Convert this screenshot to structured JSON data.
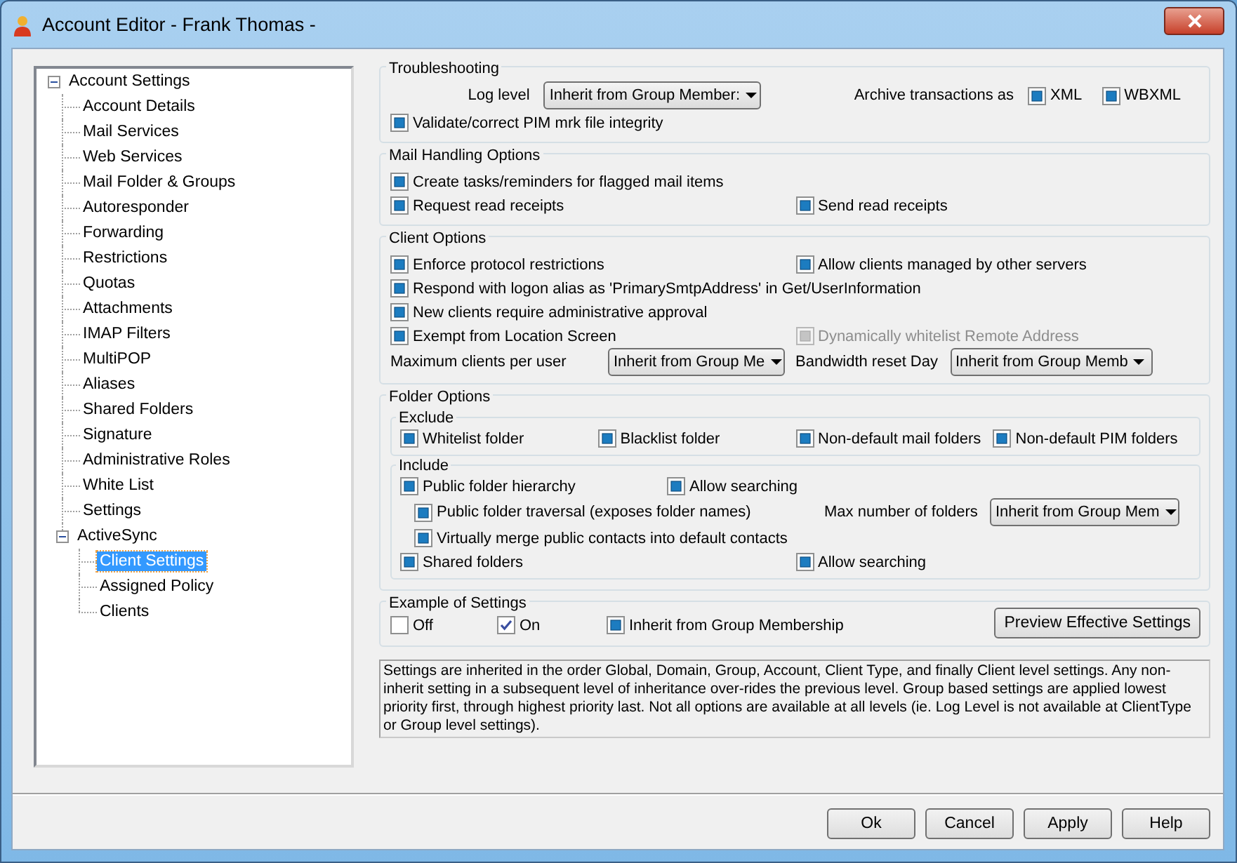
{
  "window": {
    "title": "Account Editor - Frank Thomas -"
  },
  "tree": [
    {
      "label": "Account Settings",
      "expanded": true,
      "selected": false,
      "children": [
        {
          "label": "Account Details",
          "selected": false
        },
        {
          "label": "Mail Services",
          "selected": false
        },
        {
          "label": "Web Services",
          "selected": false
        },
        {
          "label": "Mail Folder & Groups",
          "selected": false
        },
        {
          "label": "Autoresponder",
          "selected": false
        },
        {
          "label": "Forwarding",
          "selected": false
        },
        {
          "label": "Restrictions",
          "selected": false
        },
        {
          "label": "Quotas",
          "selected": false
        },
        {
          "label": "Attachments",
          "selected": false
        },
        {
          "label": "IMAP Filters",
          "selected": false
        },
        {
          "label": "MultiPOP",
          "selected": false
        },
        {
          "label": "Aliases",
          "selected": false
        },
        {
          "label": "Shared Folders",
          "selected": false
        },
        {
          "label": "Signature",
          "selected": false
        },
        {
          "label": "Administrative Roles",
          "selected": false
        },
        {
          "label": "White List",
          "selected": false
        },
        {
          "label": "Settings",
          "selected": false
        },
        {
          "label": "ActiveSync",
          "expanded": true,
          "selected": false,
          "children": [
            {
              "label": "Client Settings",
              "selected": true
            },
            {
              "label": "Assigned Policy",
              "selected": false
            },
            {
              "label": "Clients",
              "selected": false
            }
          ]
        }
      ]
    }
  ],
  "sections": [
    {
      "title": "Troubleshooting",
      "groups": [
        {
          "rows": [
            {
              "cells": [
                {
                  "kind": "field",
                  "label": "Log level",
                  "value": "Inherit from Group Member:"
                },
                {
                  "kind": "label",
                  "label": "Archive transactions as"
                },
                {
                  "kind": "check",
                  "label": "XML",
                  "inherit": true,
                  "disabled": false
                },
                {
                  "kind": "check",
                  "label": "WBXML",
                  "inherit": true,
                  "disabled": false
                }
              ]
            },
            {
              "cells": [
                {
                  "kind": "check",
                  "label": "Validate/correct PIM mrk file integrity",
                  "inherit": true,
                  "disabled": false
                }
              ]
            }
          ]
        }
      ]
    },
    {
      "title": "Mail Handling Options",
      "groups": [
        {
          "rows": [
            {
              "cells": [
                {
                  "kind": "check",
                  "label": "Create tasks/reminders for flagged mail items",
                  "inherit": true,
                  "disabled": false
                }
              ]
            },
            {
              "cells": [
                {
                  "kind": "check",
                  "label": "Request read receipts",
                  "inherit": true,
                  "disabled": false
                },
                {
                  "kind": "check",
                  "label": "Send read receipts",
                  "inherit": true,
                  "disabled": false
                }
              ]
            }
          ]
        }
      ]
    },
    {
      "title": "Client Options",
      "groups": [
        {
          "rows": [
            {
              "cells": [
                {
                  "kind": "check",
                  "label": "Enforce protocol restrictions",
                  "inherit": true,
                  "disabled": false
                },
                {
                  "kind": "check",
                  "label": "Allow clients managed by other servers",
                  "inherit": true,
                  "disabled": false
                }
              ]
            },
            {
              "cells": [
                {
                  "kind": "check",
                  "label": "Respond with logon alias as 'PrimarySmtpAddress' in Get/UserInformation",
                  "inherit": true,
                  "disabled": false
                }
              ]
            },
            {
              "cells": [
                {
                  "kind": "check",
                  "label": "New clients require administrative approval",
                  "inherit": true,
                  "disabled": false
                }
              ]
            },
            {
              "cells": [
                {
                  "kind": "check",
                  "label": "Exempt from Location Screen",
                  "inherit": true,
                  "disabled": false
                },
                {
                  "kind": "check",
                  "label": "Dynamically whitelist Remote Address",
                  "inherit": true,
                  "disabled": true
                }
              ]
            },
            {
              "cells": [
                {
                  "kind": "field",
                  "label": "Maximum clients per user",
                  "value": "Inherit from Group Me"
                },
                {
                  "kind": "field",
                  "label": "Bandwidth reset Day",
                  "value": "Inherit from Group Memb"
                }
              ]
            }
          ]
        }
      ]
    },
    {
      "title": "Folder Options",
      "groups": [
        {
          "title": "Exclude",
          "rows": [
            {
              "cells": [
                {
                  "kind": "check",
                  "label": "Whitelist folder",
                  "inherit": true,
                  "disabled": false
                },
                {
                  "kind": "check",
                  "label": "Blacklist folder",
                  "inherit": true,
                  "disabled": false
                },
                {
                  "kind": "check",
                  "label": "Non-default mail folders",
                  "inherit": true,
                  "disabled": false
                },
                {
                  "kind": "check",
                  "label": "Non-default PIM folders",
                  "inherit": true,
                  "disabled": false
                }
              ]
            }
          ]
        },
        {
          "title": "Include",
          "rows": [
            {
              "cells": [
                {
                  "kind": "check",
                  "label": "Public folder hierarchy",
                  "inherit": true,
                  "disabled": false
                },
                {
                  "kind": "check",
                  "label": "Allow searching",
                  "inherit": true,
                  "disabled": false
                }
              ]
            },
            {
              "cells": [
                {
                  "kind": "check",
                  "label": "Public folder traversal (exposes folder names)",
                  "inherit": true,
                  "disabled": false
                },
                {
                  "kind": "field",
                  "label": "Max number of folders",
                  "value": "Inherit from Group Mem"
                }
              ]
            },
            {
              "cells": [
                {
                  "kind": "check",
                  "label": "Virtually merge public contacts into default contacts",
                  "inherit": true,
                  "disabled": false
                }
              ]
            },
            {
              "cells": [
                {
                  "kind": "check",
                  "label": "Shared folders",
                  "inherit": true,
                  "disabled": false
                },
                {
                  "kind": "check",
                  "label": "Allow searching",
                  "inherit": true,
                  "disabled": false
                }
              ]
            }
          ]
        }
      ]
    },
    {
      "title": "Example of Settings",
      "groups": [
        {
          "rows": [
            {
              "cells": [
                {
                  "kind": "check",
                  "label": "Off",
                  "checked": false,
                  "inherit": false,
                  "disabled": false
                },
                {
                  "kind": "check",
                  "label": "On",
                  "checked": true,
                  "inherit": false,
                  "disabled": false
                },
                {
                  "kind": "check",
                  "label": "Inherit from Group Membership",
                  "inherit": true,
                  "disabled": false
                },
                {
                  "kind": "button",
                  "label": "Preview Effective Settings"
                }
              ]
            }
          ]
        }
      ]
    }
  ],
  "description": "Settings are inherited in the order Global, Domain, Group, Account, Client Type, and finally Client level settings. Any non-inherit setting in a subsequent level of inheritance over-rides the previous level. Group based settings are applied lowest priority first, through highest priority last. Not all options are available at all levels (ie. Log Level is not available at ClientType or Group level settings).",
  "buttons": [
    "Ok",
    "Cancel",
    "Apply",
    "Help"
  ]
}
